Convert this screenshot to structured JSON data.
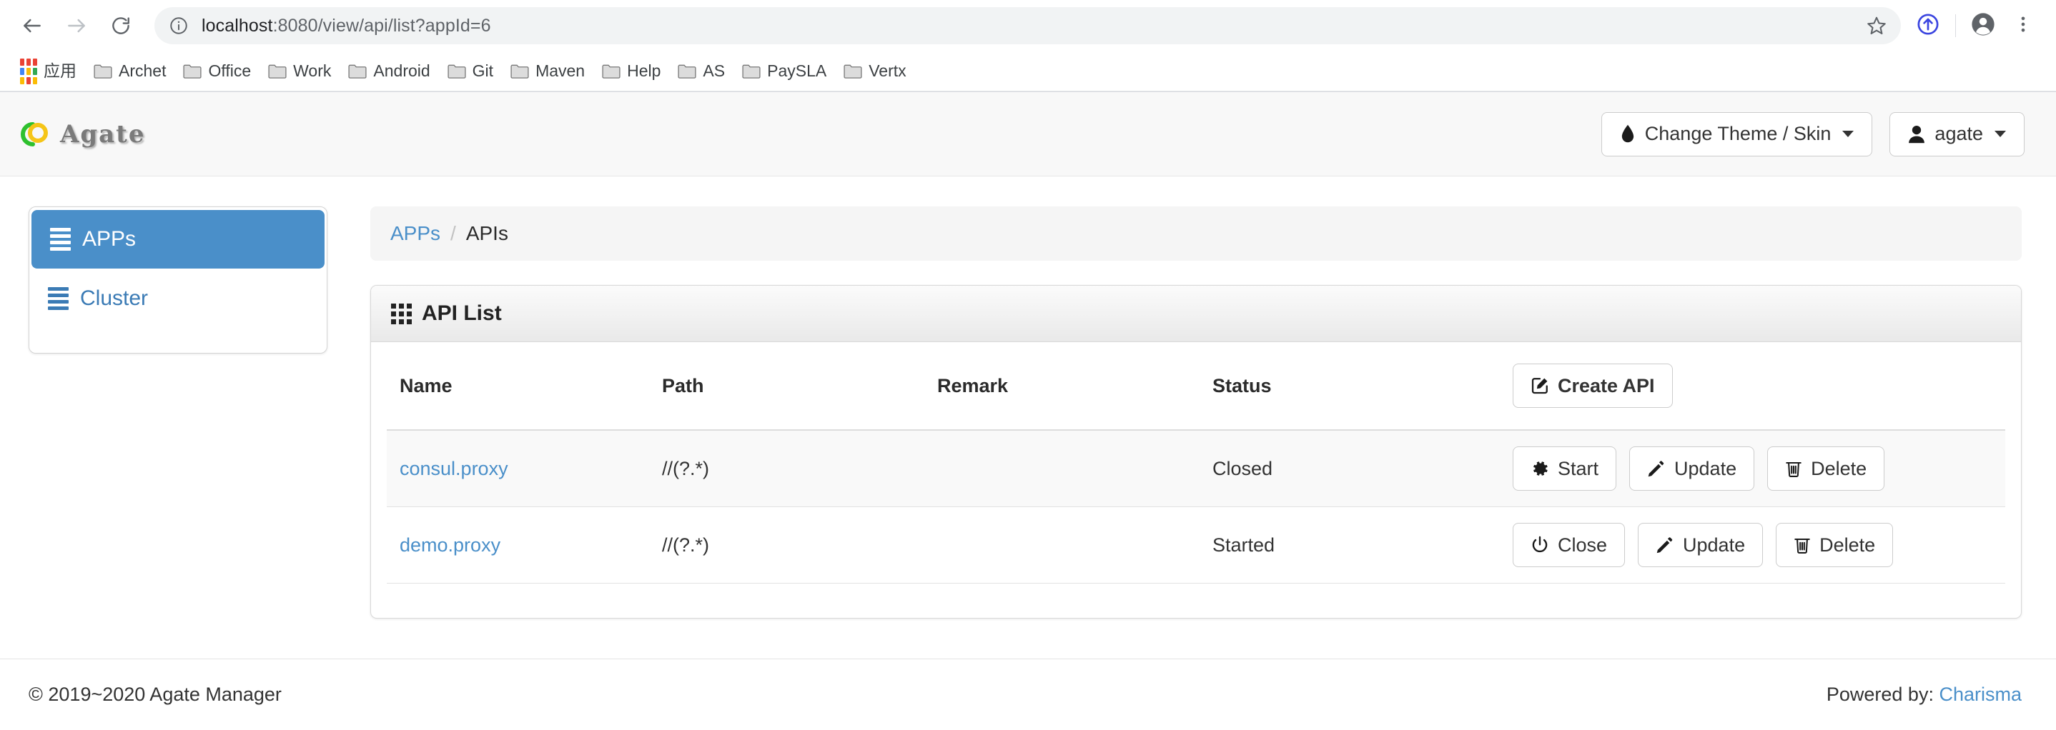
{
  "browser": {
    "back_icon": "back-arrow-icon",
    "forward_icon": "forward-arrow-icon",
    "reload_icon": "reload-icon",
    "site_info_icon": "info-circle-icon",
    "url_host": "localhost",
    "url_rest": ":8080/view/api/list?appId=6",
    "url_full": "localhost:8080/view/api/list?appId=6",
    "star_icon": "bookmark-star-icon",
    "share_icon": "share-upload-icon",
    "profile_icon": "profile-avatar-icon",
    "menu_icon": "three-dot-menu-icon",
    "bookmarks": [
      {
        "label": "应用",
        "icon": "apps-grid-icon"
      },
      {
        "label": "Archet",
        "icon": "folder-icon"
      },
      {
        "label": "Office",
        "icon": "folder-icon"
      },
      {
        "label": "Work",
        "icon": "folder-icon"
      },
      {
        "label": "Android",
        "icon": "folder-icon"
      },
      {
        "label": "Git",
        "icon": "folder-icon"
      },
      {
        "label": "Maven",
        "icon": "folder-icon"
      },
      {
        "label": "Help",
        "icon": "folder-icon"
      },
      {
        "label": "AS",
        "icon": "folder-icon"
      },
      {
        "label": "PaySLA",
        "icon": "folder-icon"
      },
      {
        "label": "Vertx",
        "icon": "folder-icon"
      }
    ]
  },
  "header": {
    "brand": "Agate",
    "theme_button": "Change Theme / Skin",
    "theme_icon": "tint-droplet-icon",
    "user_button": "agate",
    "user_icon": "user-icon"
  },
  "sidebar": {
    "items": [
      {
        "label": "APPs",
        "icon": "list-icon",
        "active": true
      },
      {
        "label": "Cluster",
        "icon": "list-icon",
        "active": false
      }
    ]
  },
  "breadcrumb": {
    "root": "APPs",
    "separator": "/",
    "current": "APIs"
  },
  "panel": {
    "title": "API List",
    "title_icon": "grid-th-icon",
    "create_button": "Create API",
    "create_icon": "edit-square-icon",
    "columns": [
      "Name",
      "Path",
      "Remark",
      "Status"
    ],
    "rows": [
      {
        "name": "consul.proxy",
        "path": "//(?.*)",
        "remark": "",
        "status": "Closed",
        "actions": [
          {
            "label": "Start",
            "icon": "gear-icon"
          },
          {
            "label": "Update",
            "icon": "pencil-icon"
          },
          {
            "label": "Delete",
            "icon": "trash-icon"
          }
        ]
      },
      {
        "name": "demo.proxy",
        "path": "//(?.*)",
        "remark": "",
        "status": "Started",
        "actions": [
          {
            "label": "Close",
            "icon": "power-icon"
          },
          {
            "label": "Update",
            "icon": "pencil-icon"
          },
          {
            "label": "Delete",
            "icon": "trash-icon"
          }
        ]
      }
    ]
  },
  "footer": {
    "copyright": "© 2019~2020 Agate Manager",
    "powered_label": "Powered by:",
    "powered_link": "Charisma"
  },
  "colors": {
    "accent_blue": "#4a8fc9",
    "link_blue": "#4a8fc9",
    "header_bg": "#f8f8f8",
    "panel_head_bg": "#e9e9e9",
    "breadcrumb_bg": "#f5f5f5",
    "brand_gray": "#7a7a7a",
    "logo_yellow": "#f5c518",
    "logo_green": "#2ec02e"
  }
}
